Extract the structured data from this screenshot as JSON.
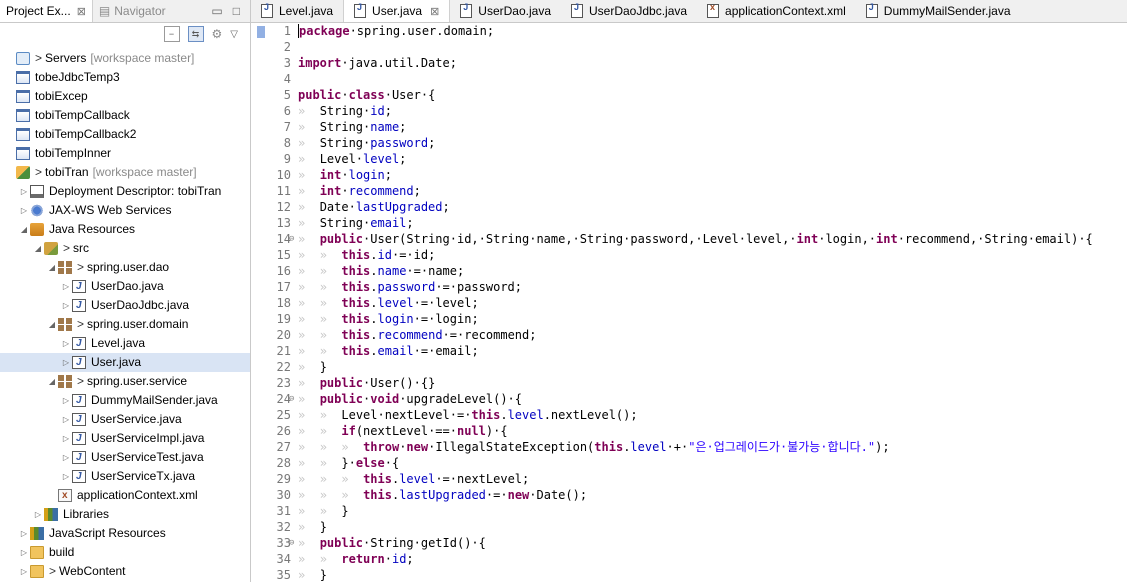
{
  "explorer": {
    "tabs": [
      {
        "label": "Project Ex...",
        "close": "⊠"
      },
      {
        "label": "Navigator"
      }
    ],
    "tree": [
      {
        "depth": 0,
        "tw": "",
        "icon": "server",
        "prefix": ">",
        "label": "Servers",
        "note": "[workspace master]"
      },
      {
        "depth": 0,
        "tw": "",
        "icon": "proj",
        "label": "tobeJdbcTemp3"
      },
      {
        "depth": 0,
        "tw": "",
        "icon": "proj",
        "label": "tobiExcep"
      },
      {
        "depth": 0,
        "tw": "",
        "icon": "proj",
        "label": "tobiTempCallback"
      },
      {
        "depth": 0,
        "tw": "",
        "icon": "proj",
        "label": "tobiTempCallback2"
      },
      {
        "depth": 0,
        "tw": "",
        "icon": "proj",
        "label": "tobiTempInner"
      },
      {
        "depth": 0,
        "tw": "",
        "icon": "web",
        "prefix": ">",
        "label": "tobiTran",
        "note": "[workspace master]"
      },
      {
        "depth": 1,
        "tw": "▷",
        "icon": "dd",
        "label": "Deployment Descriptor: tobiTran"
      },
      {
        "depth": 1,
        "tw": "▷",
        "icon": "ws",
        "label": "JAX-WS Web Services"
      },
      {
        "depth": 1,
        "tw": "◢",
        "icon": "jres",
        "label": "Java Resources"
      },
      {
        "depth": 2,
        "tw": "◢",
        "icon": "src",
        "prefix": ">",
        "label": "src"
      },
      {
        "depth": 3,
        "tw": "◢",
        "icon": "pkg",
        "prefix": ">",
        "label": "spring.user.dao"
      },
      {
        "depth": 4,
        "tw": "▷",
        "icon": "jf",
        "label": "UserDao.java"
      },
      {
        "depth": 4,
        "tw": "▷",
        "icon": "jf",
        "label": "UserDaoJdbc.java"
      },
      {
        "depth": 3,
        "tw": "◢",
        "icon": "pkg",
        "prefix": ">",
        "label": "spring.user.domain"
      },
      {
        "depth": 4,
        "tw": "▷",
        "icon": "jf",
        "label": "Level.java"
      },
      {
        "depth": 4,
        "tw": "▷",
        "icon": "jf",
        "label": "User.java",
        "selected": true
      },
      {
        "depth": 3,
        "tw": "◢",
        "icon": "pkg",
        "prefix": ">",
        "label": "spring.user.service"
      },
      {
        "depth": 4,
        "tw": "▷",
        "icon": "jf",
        "label": "DummyMailSender.java"
      },
      {
        "depth": 4,
        "tw": "▷",
        "icon": "jf",
        "label": "UserService.java"
      },
      {
        "depth": 4,
        "tw": "▷",
        "icon": "jf",
        "label": "UserServiceImpl.java"
      },
      {
        "depth": 4,
        "tw": "▷",
        "icon": "jf",
        "label": "UserServiceTest.java"
      },
      {
        "depth": 4,
        "tw": "▷",
        "icon": "jf",
        "label": "UserServiceTx.java"
      },
      {
        "depth": 3,
        "tw": "",
        "icon": "xml",
        "label": "applicationContext.xml"
      },
      {
        "depth": 2,
        "tw": "▷",
        "icon": "lib",
        "label": "Libraries"
      },
      {
        "depth": 1,
        "tw": "▷",
        "icon": "lib",
        "label": "JavaScript Resources"
      },
      {
        "depth": 1,
        "tw": "▷",
        "icon": "folder",
        "label": "build"
      },
      {
        "depth": 1,
        "tw": "▷",
        "icon": "folder",
        "prefix": ">",
        "label": "WebContent"
      }
    ]
  },
  "editor": {
    "tabs": [
      {
        "label": "Level.java",
        "type": "java"
      },
      {
        "label": "User.java",
        "type": "java",
        "active": true,
        "close": "⊠"
      },
      {
        "label": "UserDao.java",
        "type": "java"
      },
      {
        "label": "UserDaoJdbc.java",
        "type": "java"
      },
      {
        "label": "applicationContext.xml",
        "type": "xml"
      },
      {
        "label": "DummyMailSender.java",
        "type": "java"
      }
    ],
    "lines": [
      {
        "n": "1",
        "fold": "",
        "indent": 0,
        "tokens": [
          [
            "k",
            "package"
          ],
          [
            "",
            "·spring.user.domain;"
          ]
        ]
      },
      {
        "n": "2",
        "fold": "",
        "indent": 0,
        "tokens": []
      },
      {
        "n": "3",
        "fold": "",
        "indent": 0,
        "tokens": [
          [
            "k",
            "import"
          ],
          [
            "",
            "·java.util.Date;"
          ]
        ]
      },
      {
        "n": "4",
        "fold": "",
        "indent": 0,
        "tokens": []
      },
      {
        "n": "5",
        "fold": "",
        "indent": 0,
        "tokens": [
          [
            "k",
            "public"
          ],
          [
            "",
            "·"
          ],
          [
            "k",
            "class"
          ],
          [
            "",
            "·User·{"
          ]
        ]
      },
      {
        "n": "6",
        "fold": "",
        "indent": 1,
        "tokens": [
          [
            "",
            "String·"
          ],
          [
            "f",
            "id"
          ],
          [
            "",
            ";"
          ]
        ]
      },
      {
        "n": "7",
        "fold": "",
        "indent": 1,
        "tokens": [
          [
            "",
            "String·"
          ],
          [
            "f",
            "name"
          ],
          [
            "",
            ";"
          ]
        ]
      },
      {
        "n": "8",
        "fold": "",
        "indent": 1,
        "tokens": [
          [
            "",
            "String·"
          ],
          [
            "f",
            "password"
          ],
          [
            "",
            ";"
          ]
        ]
      },
      {
        "n": "9",
        "fold": "",
        "indent": 1,
        "tokens": [
          [
            "",
            "Level·"
          ],
          [
            "f",
            "level"
          ],
          [
            "",
            ";"
          ]
        ]
      },
      {
        "n": "10",
        "fold": "",
        "indent": 1,
        "tokens": [
          [
            "k",
            "int"
          ],
          [
            "",
            "·"
          ],
          [
            "f",
            "login"
          ],
          [
            "",
            ";"
          ]
        ]
      },
      {
        "n": "11",
        "fold": "",
        "indent": 1,
        "tokens": [
          [
            "k",
            "int"
          ],
          [
            "",
            "·"
          ],
          [
            "f",
            "recommend"
          ],
          [
            "",
            ";"
          ]
        ]
      },
      {
        "n": "12",
        "fold": "",
        "indent": 1,
        "tokens": [
          [
            "",
            "Date·"
          ],
          [
            "f",
            "lastUpgraded"
          ],
          [
            "",
            ";"
          ]
        ]
      },
      {
        "n": "13",
        "fold": "",
        "indent": 1,
        "tokens": [
          [
            "",
            "String·"
          ],
          [
            "f",
            "email"
          ],
          [
            "",
            ";"
          ]
        ]
      },
      {
        "n": "14",
        "fold": "⊖",
        "indent": 1,
        "tokens": [
          [
            "k",
            "public"
          ],
          [
            "",
            "·User(String·id,·String·name,·String·password,·Level·level,·"
          ],
          [
            "k",
            "int"
          ],
          [
            "",
            "·login,·"
          ],
          [
            "k",
            "int"
          ],
          [
            "",
            "·recommend,·String·email)·{"
          ]
        ]
      },
      {
        "n": "15",
        "fold": "",
        "indent": 2,
        "tokens": [
          [
            "k",
            "this"
          ],
          [
            "",
            "."
          ],
          [
            "f",
            "id"
          ],
          [
            "",
            "·=·id;"
          ]
        ]
      },
      {
        "n": "16",
        "fold": "",
        "indent": 2,
        "tokens": [
          [
            "k",
            "this"
          ],
          [
            "",
            "."
          ],
          [
            "f",
            "name"
          ],
          [
            "",
            "·=·name;"
          ]
        ]
      },
      {
        "n": "17",
        "fold": "",
        "indent": 2,
        "tokens": [
          [
            "k",
            "this"
          ],
          [
            "",
            "."
          ],
          [
            "f",
            "password"
          ],
          [
            "",
            "·=·password;"
          ]
        ]
      },
      {
        "n": "18",
        "fold": "",
        "indent": 2,
        "tokens": [
          [
            "k",
            "this"
          ],
          [
            "",
            "."
          ],
          [
            "f",
            "level"
          ],
          [
            "",
            "·=·level;"
          ]
        ]
      },
      {
        "n": "19",
        "fold": "",
        "indent": 2,
        "tokens": [
          [
            "k",
            "this"
          ],
          [
            "",
            "."
          ],
          [
            "f",
            "login"
          ],
          [
            "",
            "·=·login;"
          ]
        ]
      },
      {
        "n": "20",
        "fold": "",
        "indent": 2,
        "tokens": [
          [
            "k",
            "this"
          ],
          [
            "",
            "."
          ],
          [
            "f",
            "recommend"
          ],
          [
            "",
            "·=·recommend;"
          ]
        ]
      },
      {
        "n": "21",
        "fold": "",
        "indent": 2,
        "tokens": [
          [
            "k",
            "this"
          ],
          [
            "",
            "."
          ],
          [
            "f",
            "email"
          ],
          [
            "",
            "·=·email;"
          ]
        ]
      },
      {
        "n": "22",
        "fold": "",
        "indent": 1,
        "tokens": [
          [
            "",
            "}"
          ]
        ]
      },
      {
        "n": "23",
        "fold": "",
        "indent": 1,
        "tokens": [
          [
            "k",
            "public"
          ],
          [
            "",
            "·User()·{}"
          ]
        ]
      },
      {
        "n": "24",
        "fold": "⊖",
        "indent": 1,
        "tokens": [
          [
            "k",
            "public"
          ],
          [
            "",
            "·"
          ],
          [
            "k",
            "void"
          ],
          [
            "",
            "·upgradeLevel()·{"
          ]
        ]
      },
      {
        "n": "25",
        "fold": "",
        "indent": 2,
        "tokens": [
          [
            "",
            "Level·nextLevel·=·"
          ],
          [
            "k",
            "this"
          ],
          [
            "",
            "."
          ],
          [
            "f",
            "level"
          ],
          [
            "",
            ".nextLevel();"
          ]
        ]
      },
      {
        "n": "26",
        "fold": "",
        "indent": 2,
        "tokens": [
          [
            "k",
            "if"
          ],
          [
            "",
            "(nextLevel·==·"
          ],
          [
            "k",
            "null"
          ],
          [
            "",
            ")·{"
          ]
        ]
      },
      {
        "n": "27",
        "fold": "",
        "indent": 3,
        "tokens": [
          [
            "k",
            "throw"
          ],
          [
            "",
            "·"
          ],
          [
            "k",
            "new"
          ],
          [
            "",
            "·IllegalStateException("
          ],
          [
            "k",
            "this"
          ],
          [
            "",
            "."
          ],
          [
            "f",
            "level"
          ],
          [
            "",
            "·+·"
          ],
          [
            "s",
            "\"은·업그레이드가·불가능·합니다.\""
          ],
          [
            "",
            ");"
          ]
        ]
      },
      {
        "n": "28",
        "fold": "",
        "indent": 2,
        "tokens": [
          [
            "",
            "}·"
          ],
          [
            "k",
            "else"
          ],
          [
            "",
            "·{"
          ]
        ]
      },
      {
        "n": "29",
        "fold": "",
        "indent": 3,
        "tokens": [
          [
            "k",
            "this"
          ],
          [
            "",
            "."
          ],
          [
            "f",
            "level"
          ],
          [
            "",
            "·=·nextLevel;"
          ]
        ]
      },
      {
        "n": "30",
        "fold": "",
        "indent": 3,
        "tokens": [
          [
            "k",
            "this"
          ],
          [
            "",
            "."
          ],
          [
            "f",
            "lastUpgraded"
          ],
          [
            "",
            "·=·"
          ],
          [
            "k",
            "new"
          ],
          [
            "",
            "·Date();"
          ]
        ]
      },
      {
        "n": "31",
        "fold": "",
        "indent": 2,
        "tokens": [
          [
            "",
            "}"
          ]
        ]
      },
      {
        "n": "32",
        "fold": "",
        "indent": 1,
        "tokens": [
          [
            "",
            "}"
          ]
        ]
      },
      {
        "n": "33",
        "fold": "⊖",
        "indent": 1,
        "tokens": [
          [
            "k",
            "public"
          ],
          [
            "",
            "·String·getId()·{"
          ]
        ]
      },
      {
        "n": "34",
        "fold": "",
        "indent": 2,
        "tokens": [
          [
            "k",
            "return"
          ],
          [
            "",
            "·"
          ],
          [
            "f",
            "id"
          ],
          [
            "",
            ";"
          ]
        ]
      },
      {
        "n": "35",
        "fold": "",
        "indent": 1,
        "tokens": [
          [
            "",
            "}"
          ]
        ]
      }
    ]
  }
}
